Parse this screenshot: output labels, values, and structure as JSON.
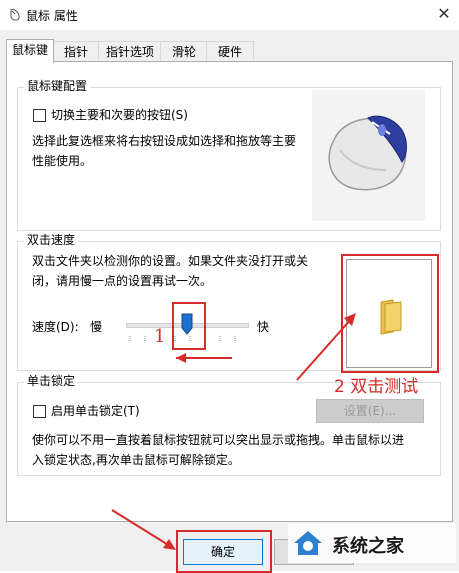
{
  "window": {
    "title": "鼠标 属性",
    "close_glyph": "✕"
  },
  "tabs": [
    {
      "label": "鼠标键"
    },
    {
      "label": "指针"
    },
    {
      "label": "指针选项"
    },
    {
      "label": "滑轮"
    },
    {
      "label": "硬件"
    }
  ],
  "button_config": {
    "group_label": "鼠标键配置",
    "swap_checkbox_label": "切换主要和次要的按钮(S)",
    "swap_checked": false,
    "description_lines": [
      "选择此复选框来将右按钮设成如选择和拖放等主要",
      "性能使用。"
    ]
  },
  "double_click": {
    "group_label": "双击速度",
    "description_lines": [
      "双击文件夹以检测你的设置。如果文件夹没打开或关",
      "闭，请用慢一点的设置再试一次。"
    ],
    "speed_label": "速度(D):",
    "slow_label": "慢",
    "fast_label": "快",
    "slider_fraction": 0.5
  },
  "click_lock": {
    "group_label": "单击锁定",
    "checkbox_label": "启用单击锁定(T)",
    "checked": false,
    "settings_button": "设置(E)...",
    "description_lines": [
      "使你可以不用一直按着鼠标按钮就可以突出显示或拖拽。单击鼠标以进",
      "入锁定状态,再次单击鼠标可解除锁定。"
    ]
  },
  "footer": {
    "ok_button": "确定"
  },
  "annotations": {
    "step1": "1",
    "step2": "2 双击测试"
  },
  "watermark": {
    "text": "系统之家"
  },
  "colors": {
    "annotation_red": "#d62b2b",
    "slider_thumb": "#1a6fcf",
    "folder": "#f3d36a"
  }
}
